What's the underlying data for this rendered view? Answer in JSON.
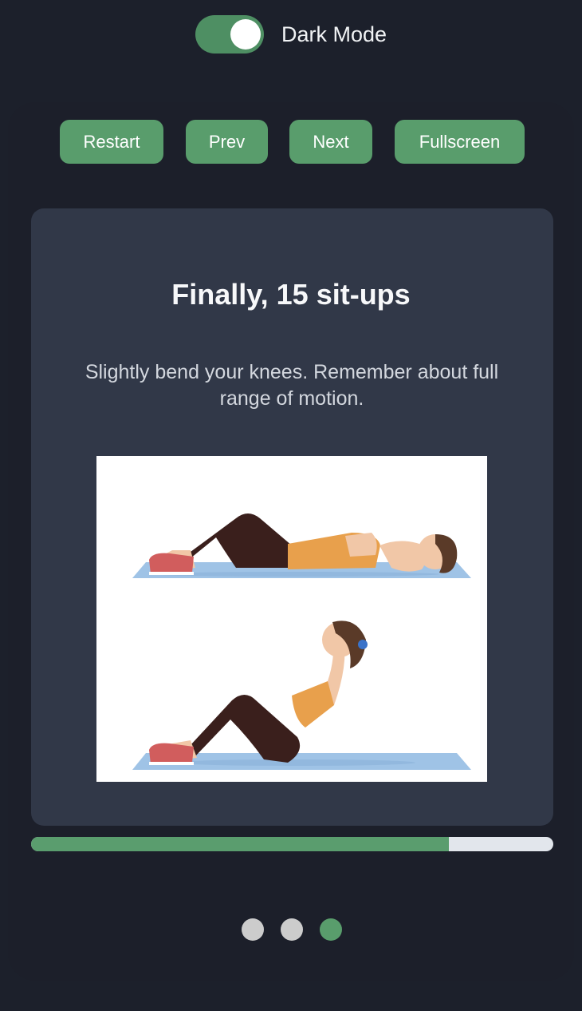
{
  "toggle": {
    "label": "Dark Mode",
    "on": true
  },
  "controls": {
    "restart_label": "Restart",
    "prev_label": "Prev",
    "next_label": "Next",
    "fullscreen_label": "Fullscreen"
  },
  "card": {
    "title": "Finally, 15 sit-ups",
    "description": "Slightly bend your knees. Remember about full range of motion.",
    "image": "sit-up exercise illustration"
  },
  "progress": {
    "fraction": 0.8
  },
  "pagination": {
    "total": 3,
    "current": 3
  },
  "colors": {
    "accent": "#599d6c",
    "background": "#1c202b",
    "card": "#313848",
    "dot_inactive": "#cccccc",
    "dot_active": "#599d6c"
  }
}
